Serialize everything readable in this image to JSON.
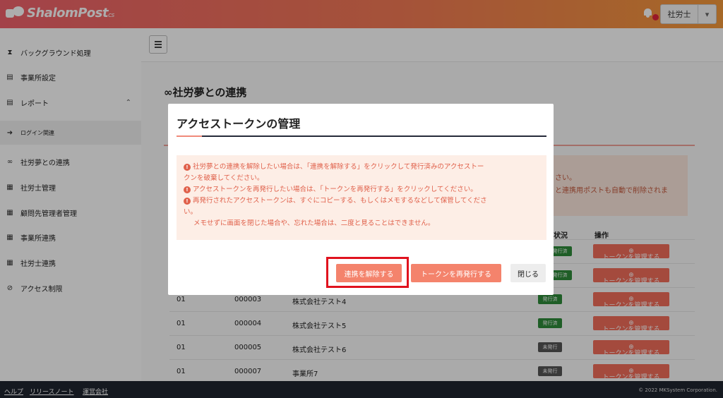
{
  "header": {
    "logo_text": "ShalomPost",
    "logo_sub": "cs",
    "user_label": "社労士"
  },
  "sidebar": {
    "items": [
      {
        "label": "バックグラウンド処理",
        "icon": "hourglass-icon"
      },
      {
        "label": "事業所設定",
        "icon": "document-icon"
      },
      {
        "label": "レポート",
        "icon": "report-icon"
      },
      {
        "label": "ログイン関連",
        "icon": "login-icon"
      },
      {
        "label": "社労夢との連携",
        "icon": "link-icon"
      },
      {
        "label": "社労士管理",
        "icon": "id-card-icon"
      },
      {
        "label": "顧問先管理者管理",
        "icon": "id-card-icon"
      },
      {
        "label": "事業所連携",
        "icon": "id-card-icon"
      },
      {
        "label": "社労士連携",
        "icon": "id-card-icon"
      },
      {
        "label": "アクセス制限",
        "icon": "ban-icon"
      }
    ]
  },
  "main": {
    "page_title": "社労夢との連携",
    "bg_alert": {
      "line1": "さい。",
      "line2": "と連携用ポストも自動で削除されま"
    },
    "table": {
      "headers": {
        "status": "状況",
        "ops": "操作"
      },
      "rows": [
        {
          "col1": "",
          "col2": "",
          "name": "",
          "status": "発行済",
          "status_type": "issued"
        },
        {
          "col1": "",
          "col2": "",
          "name": "",
          "status": "発行済",
          "status_type": "issued"
        },
        {
          "col1": "01",
          "col2": "000003",
          "name": "株式会社テスト4",
          "status": "発行済",
          "status_type": "issued"
        },
        {
          "col1": "01",
          "col2": "000004",
          "name": "株式会社テスト5",
          "status": "発行済",
          "status_type": "issued"
        },
        {
          "col1": "01",
          "col2": "000005",
          "name": "株式会社テスト6",
          "status": "未発行",
          "status_type": "unissued"
        },
        {
          "col1": "01",
          "col2": "000007",
          "name": "事業所7",
          "status": "未発行",
          "status_type": "unissued"
        }
      ],
      "token_button_label": "トークンを管理する"
    }
  },
  "footer": {
    "links": [
      "ヘルプ",
      "リリースノート",
      "運営会社"
    ],
    "copyright": "© 2022 MKSystem Corporation."
  },
  "modal": {
    "title": "アクセストークンの管理",
    "alert_lines": [
      {
        "icon": true,
        "text": "社労夢との連携を解除したい場合は、「連携を解除する」をクリックして発行済みのアクセストー"
      },
      {
        "icon": false,
        "text": "クンを破棄してください。"
      },
      {
        "icon": true,
        "text": "アクセストークンを再発行したい場合は、「トークンを再発行する」をクリックしてください。"
      },
      {
        "icon": true,
        "text": "再発行されたアクセストークンは、すぐにコピーする、もしくはメモするなどして保管してくださ"
      },
      {
        "icon": false,
        "text": "い。"
      },
      {
        "icon": false,
        "text": "メモせずに画面を閉じた場合や、忘れた場合は、二度と見ることはできません。"
      }
    ],
    "buttons": {
      "unlink": "連携を解除する",
      "reissue": "トークンを再発行する",
      "close": "閉じる"
    }
  },
  "colors": {
    "accent": "#f4836c",
    "alert_text": "#e0604a",
    "highlight": "#e0121e"
  }
}
